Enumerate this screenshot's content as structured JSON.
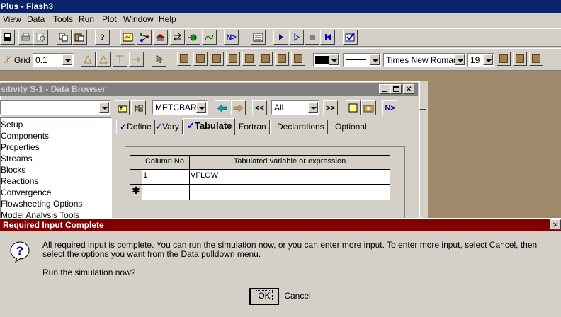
{
  "app": {
    "title": "Plus - Flash3"
  },
  "menu": [
    "View",
    "Data",
    "Tools",
    "Run",
    "Plot",
    "Window",
    "Help"
  ],
  "toolbar2": {
    "grid_label": "Grid",
    "grid_value": "0.1",
    "font_name": "Times New Roman",
    "font_size": "19"
  },
  "browser": {
    "title": "sitivity S-1 - Data Browser",
    "block_combo": "METCBAR",
    "filter_combo": "All",
    "nav_items": [
      "Setup",
      "Components",
      "Properties",
      "Streams",
      "Blocks",
      "Reactions",
      "Convergence",
      "Flowsheeting Options",
      "Model Analysis Tools"
    ],
    "tabs": [
      {
        "label": "Define",
        "checked": true
      },
      {
        "label": "Vary",
        "checked": true
      },
      {
        "label": "Tabulate",
        "checked": true
      },
      {
        "label": "Fortran",
        "checked": false
      },
      {
        "label": "Declarations",
        "checked": false
      },
      {
        "label": "Optional",
        "checked": false
      }
    ],
    "table": {
      "headers": [
        "Column No.",
        "Tabulated variable or expression"
      ],
      "rows": [
        {
          "col": "1",
          "expr": "VFLOW"
        }
      ],
      "new_row_marker": "✱"
    }
  },
  "dialog": {
    "title": "Required Input Complete",
    "message": "All required input is complete. You can run the simulation now, or you can enter more input. To enter more input, select Cancel, then select the options you want from the Data pulldown menu.",
    "question": "Run the simulation now?",
    "ok_label": "OK",
    "cancel_label": "Cancel",
    "close_label": "×"
  },
  "icons": {
    "help": "?",
    "next": "N>"
  },
  "colors": {
    "dialog_title_bg": "#800000",
    "desktop_bg": "#a0896a",
    "active_title_bg": "#0a246a"
  }
}
